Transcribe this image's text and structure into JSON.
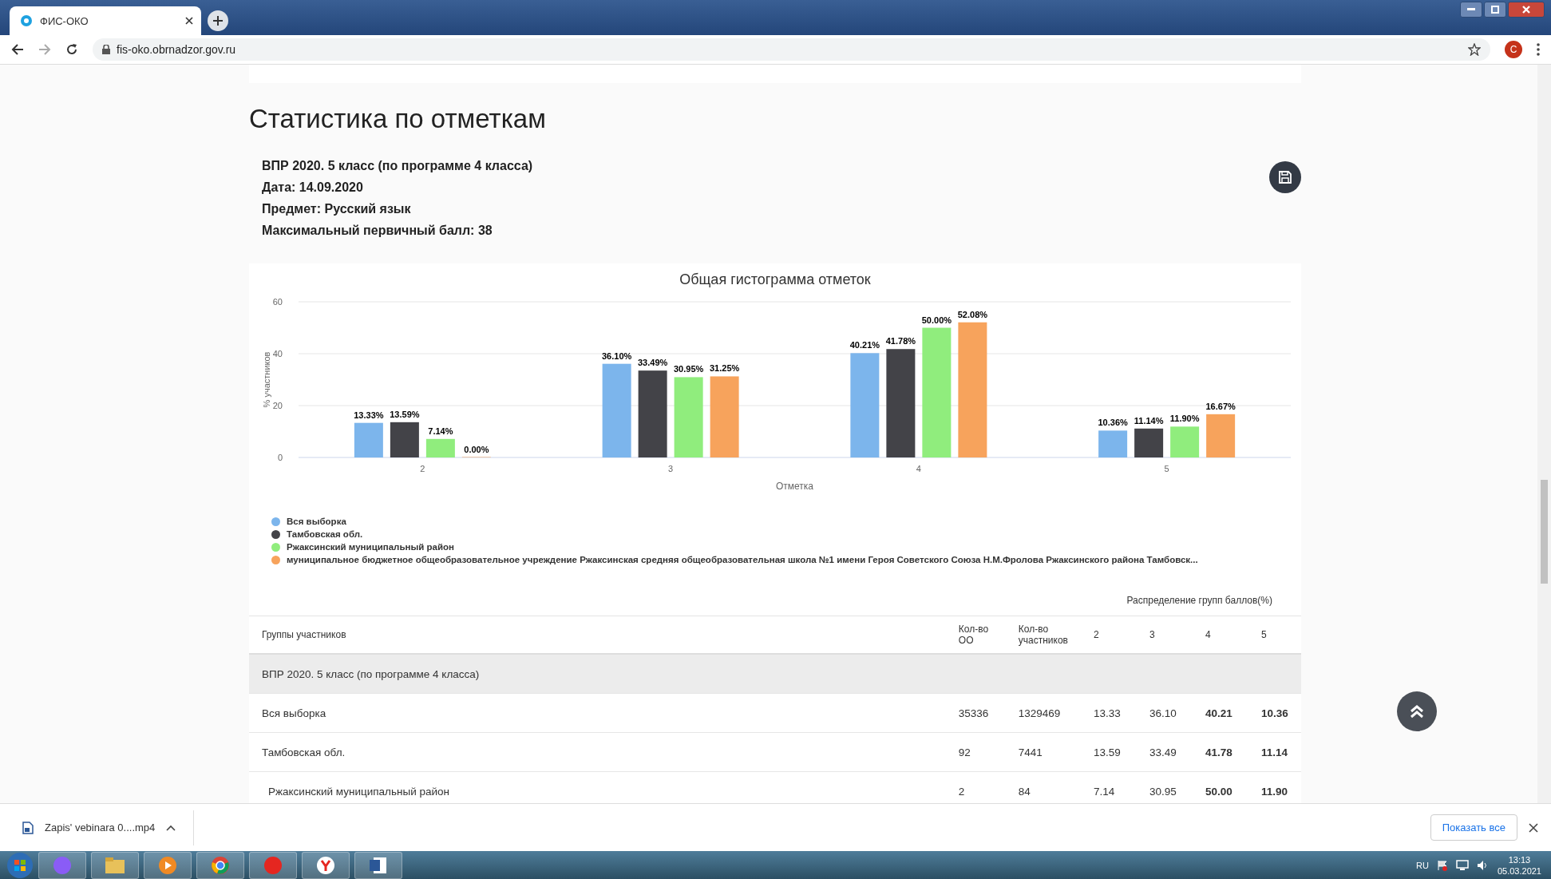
{
  "browser": {
    "tab_title": "ФИС-ОКО",
    "url": "fis-oko.obrnadzor.gov.ru",
    "profile_initial": "C"
  },
  "page": {
    "title": "Статистика по отметкам",
    "info": [
      "ВПР 2020. 5 класс (по программе 4 класса)",
      "Дата: 14.09.2020",
      "Предмет: Русский язык",
      "Максимальный первичный балл: 38"
    ]
  },
  "chart": {
    "chart_data": {
      "type": "bar",
      "title": "Общая гистограмма отметок",
      "xlabel": "Отметка",
      "ylabel": "% участников",
      "categories": [
        "2",
        "3",
        "4",
        "5"
      ],
      "ylim": [
        0,
        60
      ],
      "yticks": [
        0,
        20,
        40,
        60
      ],
      "data_labels": true,
      "series": [
        {
          "name": "Вся выборка",
          "color": "#7cb5ec",
          "values": [
            13.33,
            36.1,
            40.21,
            10.36
          ],
          "value_labels": [
            "13.33%",
            "36.10%",
            "40.21%",
            "10.36%"
          ]
        },
        {
          "name": "Тамбовская обл.",
          "color": "#434348",
          "values": [
            13.59,
            33.49,
            41.78,
            11.14
          ],
          "value_labels": [
            "13.59%",
            "33.49%",
            "41.78%",
            "11.14%"
          ]
        },
        {
          "name": "Ржаксинский муниципальный район",
          "color": "#90ed7d",
          "values": [
            7.14,
            30.95,
            50.0,
            11.9
          ],
          "value_labels": [
            "7.14%",
            "30.95%",
            "50.00%",
            "11.90%"
          ]
        },
        {
          "name": "муниципальное бюджетное общеобразовательное учреждение Ржаксинская средняя общеобразовательная школа №1 имени Героя Советского Союза Н.М.Фролова Ржаксинского района Тамбовск...",
          "color": "#f7a35c",
          "values": [
            0.0,
            31.25,
            52.08,
            16.67
          ],
          "value_labels": [
            "0.00%",
            "31.25%",
            "52.08%",
            "16.67%"
          ]
        }
      ]
    }
  },
  "table": {
    "group_header": "Распределение групп баллов(%)",
    "columns": [
      "Группы участников",
      "Кол-во ОО",
      "Кол-во участников",
      "2",
      "3",
      "4",
      "5"
    ],
    "section": "ВПР 2020. 5 класс (по программе 4 класса)",
    "rows": [
      {
        "cells": [
          "Вся выборка",
          "35336",
          "1329469",
          "13.33",
          "36.10",
          "40.21",
          "10.36"
        ]
      },
      {
        "cells": [
          "Тамбовская обл.",
          "92",
          "7441",
          "13.59",
          "33.49",
          "41.78",
          "11.14"
        ],
        "children": [
          {
            "cells": [
              "Ржаксинский муниципальный район",
              "2",
              "84",
              "7.14",
              "30.95",
              "50.00",
              "11.90"
            ]
          }
        ]
      }
    ]
  },
  "download_bar": {
    "file": "Zapis' vebinara 0....mp4",
    "show_all": "Показать все"
  },
  "taskbar": {
    "language": "RU",
    "time": "13:13",
    "date": "05.03.2021"
  }
}
